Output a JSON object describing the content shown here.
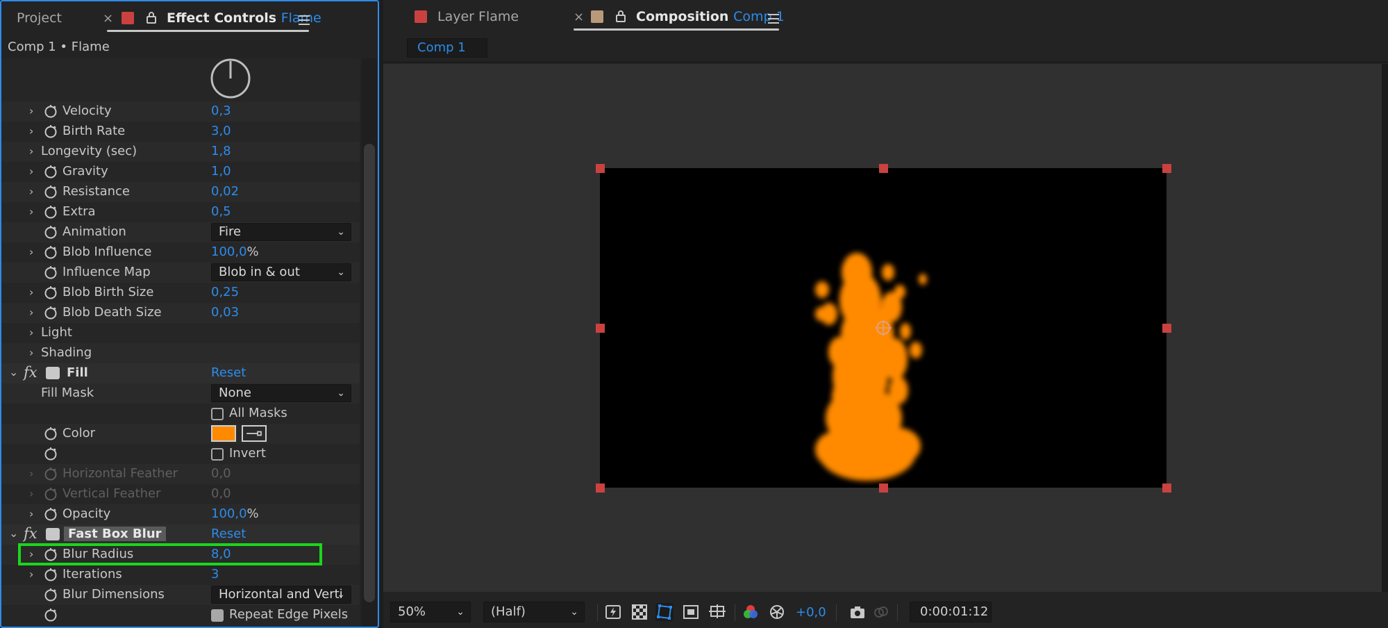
{
  "left_panel": {
    "tabs": {
      "project": "Project",
      "effect_controls_label": "Effect Controls",
      "effect_controls_layer": "Flame"
    },
    "header": "Comp 1 • Flame",
    "properties": [
      {
        "label": "Velocity",
        "value": "0,3"
      },
      {
        "label": "Birth Rate",
        "value": "3,0"
      },
      {
        "label": "Longevity (sec)",
        "value": "1,8"
      },
      {
        "label": "Gravity",
        "value": "1,0"
      },
      {
        "label": "Resistance",
        "value": "0,02"
      },
      {
        "label": "Extra",
        "value": "0,5"
      },
      {
        "label": "Animation",
        "value": "Fire"
      },
      {
        "label": "Blob Influence",
        "value": "100,0",
        "unit": "%"
      },
      {
        "label": "Influence Map",
        "value": "Blob in & out"
      },
      {
        "label": "Blob Birth Size",
        "value": "0,25"
      },
      {
        "label": "Blob Death Size",
        "value": "0,03"
      },
      {
        "label": "Light"
      },
      {
        "label": "Shading"
      }
    ],
    "fill_effect": {
      "fx": "fx",
      "name": "Fill",
      "reset": "Reset",
      "fill_mask_label": "Fill Mask",
      "fill_mask_value": "None",
      "all_masks_label": "All Masks",
      "color_label": "Color",
      "color_value": "#ff8a00",
      "invert_label": "Invert",
      "horizontal_feather_label": "Horizontal Feather",
      "horizontal_feather_value": "0,0",
      "vertical_feather_label": "Vertical Feather",
      "vertical_feather_value": "0,0",
      "opacity_label": "Opacity",
      "opacity_value": "100,0",
      "opacity_unit": "%"
    },
    "blur_effect": {
      "fx": "fx",
      "name": "Fast Box Blur",
      "reset": "Reset",
      "blur_radius_label": "Blur Radius",
      "blur_radius_value": "8,0",
      "iterations_label": "Iterations",
      "iterations_value": "3",
      "blur_dimensions_label": "Blur Dimensions",
      "blur_dimensions_value": "Horizontal and Verti",
      "repeat_edge_label": "Repeat Edge Pixels"
    }
  },
  "right_panel": {
    "tabs": {
      "layer_label": "Layer Flame",
      "composition_label": "Composition",
      "composition_name": "Comp 1"
    },
    "comp_chip": "Comp 1",
    "bottom_bar": {
      "zoom": "50%",
      "resolution": "(Half)",
      "exposure": "+0,0",
      "timecode": "0:00:01:12"
    }
  },
  "colors": {
    "accent": "#2d8ceb",
    "highlight": "#1bd61b",
    "handle": "#c9423f",
    "flame": "#ff8a00",
    "composition_swatch": "#b89a7a",
    "layer_swatch": "#c9423f"
  }
}
